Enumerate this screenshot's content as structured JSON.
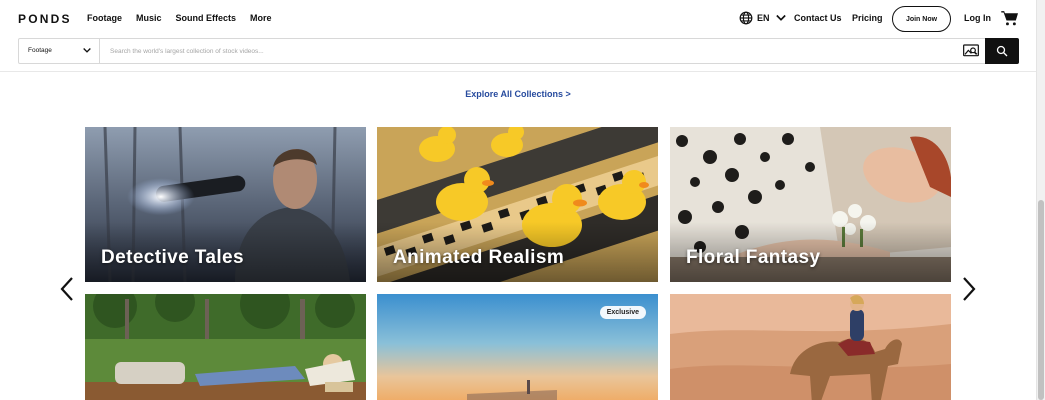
{
  "header": {
    "logo": "PONDS",
    "nav": [
      "Footage",
      "Music",
      "Sound Effects",
      "More"
    ],
    "language": "EN",
    "contact": "Contact Us",
    "pricing": "Pricing",
    "join": "Join Now",
    "login": "Log In",
    "icons": {
      "language": "globe-icon",
      "cart": "cart-icon",
      "dropdown": "chevron-down-icon"
    }
  },
  "search": {
    "category": "Footage",
    "placeholder": "Search the world's largest collection of stock videos...",
    "value": "",
    "icons": {
      "visual_search": "image-search-icon",
      "submit": "search-icon"
    }
  },
  "explore_link": "Explore All Collections >",
  "carousel": {
    "icons": {
      "prev": "chevron-left-icon",
      "next": "chevron-right-icon"
    },
    "collections": [
      {
        "title": "Detective Tales",
        "badge": ""
      },
      {
        "title": "Animated Realism",
        "badge": ""
      },
      {
        "title": "Floral Fantasy",
        "badge": ""
      },
      {
        "title": "",
        "badge": ""
      },
      {
        "title": "",
        "badge": "Exclusive"
      },
      {
        "title": "",
        "badge": ""
      }
    ]
  },
  "colors": {
    "accent_link": "#274b9e",
    "search_button": "#111111",
    "text": "#111111"
  }
}
